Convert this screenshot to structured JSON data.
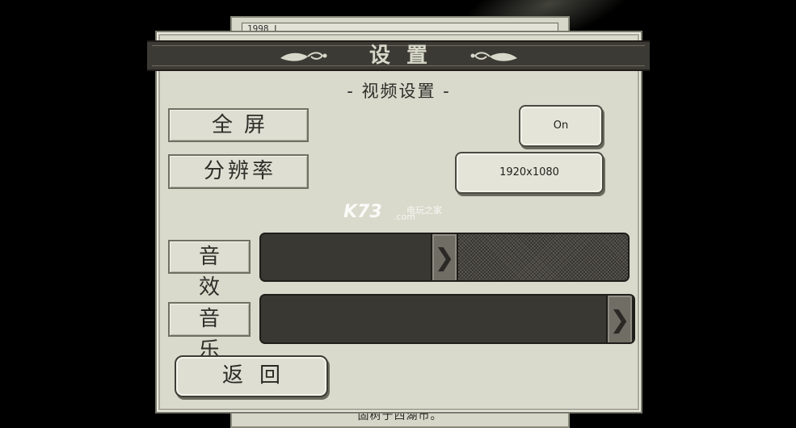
{
  "background_paper": {
    "top_text": "1998 L",
    "bottom_text": "固树于西湖市。"
  },
  "dialog": {
    "title": "设置",
    "section_title": "- 视频设置 -",
    "fullscreen": {
      "label": "全屏",
      "value": "On"
    },
    "resolution": {
      "label": "分辨率",
      "value": "1920x1080"
    },
    "watermark": {
      "brand": "K73",
      "site": "电玩之家",
      "domain": ".com"
    },
    "sfx": {
      "label": "音效",
      "level": 0.5,
      "handle_glyph": "❯"
    },
    "music": {
      "label": "音乐",
      "level": 1.0,
      "handle_glyph": "❯"
    },
    "back_button": "返回"
  },
  "colors": {
    "panel": "#d9d9cc",
    "title_bar": "#3c3a34",
    "slider_track": "#3a3833",
    "handle": "#6f6d64"
  },
  "icons": {
    "ornament_left": "leaf-ornament-icon",
    "ornament_right": "leaf-ornament-icon",
    "slider_handle": "double-chevron-right-icon"
  }
}
